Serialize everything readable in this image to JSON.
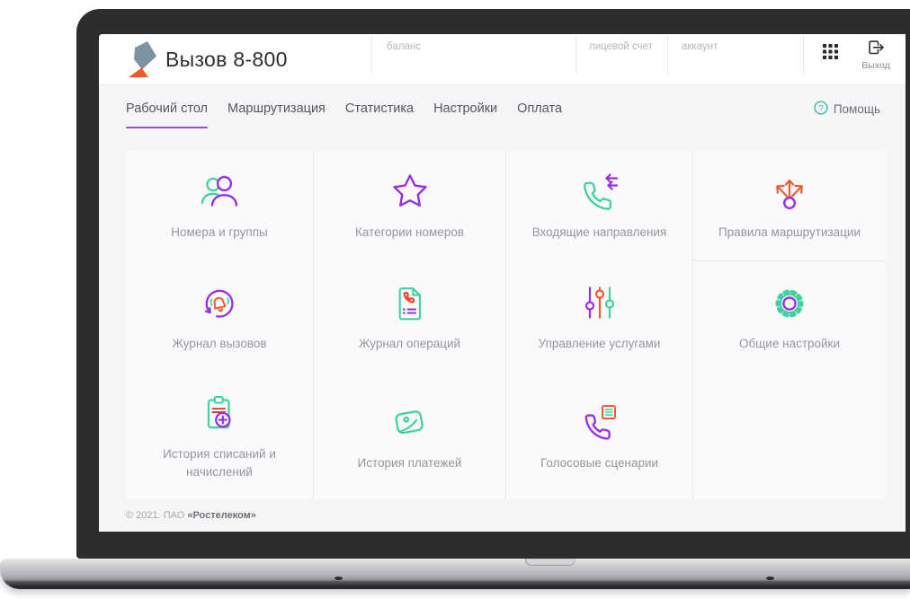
{
  "header": {
    "app_title": "Вызов 8-800",
    "account_fields": [
      {
        "label": "баланс"
      },
      {
        "label": "лицевой счет"
      },
      {
        "label": "аккаунт"
      }
    ],
    "logout_label": "Выход"
  },
  "nav": {
    "tabs": [
      {
        "label": "Рабочий стол",
        "active": true
      },
      {
        "label": "Маршрутизация",
        "active": false
      },
      {
        "label": "Статистика",
        "active": false
      },
      {
        "label": "Настройки",
        "active": false
      },
      {
        "label": "Оплата",
        "active": false
      }
    ],
    "help_label": "Помощь"
  },
  "tiles": [
    {
      "label": "Номера и группы",
      "icon": "users-icon"
    },
    {
      "label": "Категории номеров",
      "icon": "star-icon"
    },
    {
      "label": "Входящие направления",
      "icon": "phone-incoming-icon"
    },
    {
      "label": "Правила маршрутизации",
      "icon": "route-split-icon"
    },
    {
      "label": "Журнал вызовов",
      "icon": "bell-refresh-icon"
    },
    {
      "label": "Журнал операций",
      "icon": "document-phone-icon"
    },
    {
      "label": "Управление услугами",
      "icon": "sliders-icon"
    },
    {
      "label": "Общие настройки",
      "icon": "gear-icon"
    },
    {
      "label": "История списаний и начислений",
      "icon": "clipboard-plus-icon"
    },
    {
      "label": "История платежей",
      "icon": "wallet-icon"
    },
    {
      "label": "Голосовые сценарии",
      "icon": "phone-script-icon"
    }
  ],
  "footer": {
    "copyright": "© 2021. ПАО ",
    "company": "«Ростелеком»"
  },
  "colors": {
    "purple": "#9430e6",
    "teal": "#3fd1a0",
    "orange": "#f2592c",
    "tab_underline": "#9b4ce0",
    "logo_slate": "#7e93a0",
    "logo_orange": "#f15a24"
  }
}
